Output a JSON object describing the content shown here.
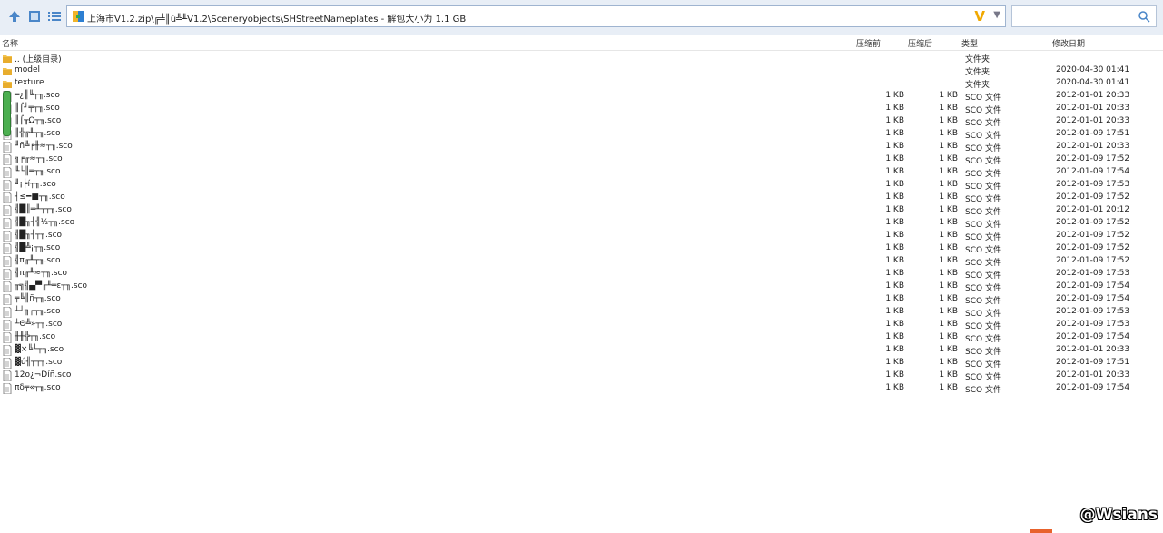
{
  "toolbar": {
    "icons": [
      "up-arrow-icon",
      "view-icon",
      "list-view-icon"
    ],
    "address": "上海市V1.2.zip\\╔╧║ú╩╨V1.2\\Sceneryobjects\\SHStreetNameplates - 解包大小为 1.1 GB",
    "search_placeholder": ""
  },
  "columns": {
    "name": "名称",
    "before": "压缩前",
    "after": "压缩后",
    "type": "类型",
    "date": "修改日期"
  },
  "rows": [
    {
      "icon": "folder",
      "name": ".. (上级目录)",
      "before": "",
      "after": "",
      "type": "文件夹",
      "date": ""
    },
    {
      "icon": "folder",
      "name": "model",
      "before": "",
      "after": "",
      "type": "文件夹",
      "date": "2020-04-30 01:41"
    },
    {
      "icon": "folder",
      "name": "texture",
      "before": "",
      "after": "",
      "type": "文件夹",
      "date": "2020-04-30 01:41"
    },
    {
      "icon": "file",
      "name": "═¿║╚┬╖.sco",
      "before": "1 KB",
      "after": "1 KB",
      "type": "SCO 文件",
      "date": "2012-01-01 20:33"
    },
    {
      "icon": "file",
      "name": "║⌠┘╤┬╖.sco",
      "before": "1 KB",
      "after": "1 KB",
      "type": "SCO 文件",
      "date": "2012-01-01 20:33"
    },
    {
      "icon": "file",
      "name": "║⌠╥Ω┬╖.sco",
      "before": "1 KB",
      "after": "1 KB",
      "type": "SCO 文件",
      "date": "2012-01-01 20:33"
    },
    {
      "icon": "file",
      "name": "║╬╔╨┬╖.sco",
      "before": "1 KB",
      "after": "1 KB",
      "type": "SCO 文件",
      "date": "2012-01-09 17:51"
    },
    {
      "icon": "file",
      "name": "╜ñ╩╒╫≈┬╖.sco",
      "before": "1 KB",
      "after": "1 KB",
      "type": "SCO 文件",
      "date": "2012-01-01 20:33"
    },
    {
      "icon": "file",
      "name": "╗╒╓≈┬╖.sco",
      "before": "1 KB",
      "after": "1 KB",
      "type": "SCO 文件",
      "date": "2012-01-09 17:52"
    },
    {
      "icon": "file",
      "name": "╙└║═┬╖.sco",
      "before": "1 KB",
      "after": "1 KB",
      "type": "SCO 文件",
      "date": "2012-01-09 17:54"
    },
    {
      "icon": "file",
      "name": "╝¡╞í┬╖.sco",
      "before": "1 KB",
      "after": "1 KB",
      "type": "SCO 文件",
      "date": "2012-01-09 17:53"
    },
    {
      "icon": "file",
      "name": "┤≤━■┬╖.sco",
      "before": "1 KB",
      "after": "1 KB",
      "type": "SCO 文件",
      "date": "2012-01-09 17:52"
    },
    {
      "icon": "file",
      "name": "╣█║═╨┬┬╖.sco",
      "before": "1 KB",
      "after": "1 KB",
      "type": "SCO 文件",
      "date": "2012-01-01 20:12"
    },
    {
      "icon": "file",
      "name": "╣█╖┤╣½┬╖.sco",
      "before": "1 KB",
      "after": "1 KB",
      "type": "SCO 文件",
      "date": "2012-01-09 17:52"
    },
    {
      "icon": "file",
      "name": "╣█╖┤┬╖.sco",
      "before": "1 KB",
      "after": "1 KB",
      "type": "SCO 文件",
      "date": "2012-01-09 17:52"
    },
    {
      "icon": "file",
      "name": "╣█╩¡┬╖.sco",
      "before": "1 KB",
      "after": "1 KB",
      "type": "SCO 文件",
      "date": "2012-01-09 17:52"
    },
    {
      "icon": "file",
      "name": "╣π╓╨┬╖.sco",
      "before": "1 KB",
      "after": "1 KB",
      "type": "SCO 文件",
      "date": "2012-01-09 17:52"
    },
    {
      "icon": "file",
      "name": "╣π╓╨≈┬╖.sco",
      "before": "1 KB",
      "after": "1 KB",
      "type": "SCO 文件",
      "date": "2012-01-09 17:53"
    },
    {
      "icon": "file",
      "name": "╥╗╣▄▀╓╨═ε┬╖.sco",
      "before": "1 KB",
      "after": "1 KB",
      "type": "SCO 文件",
      "date": "2012-01-09 17:54"
    },
    {
      "icon": "file",
      "name": "╤╚║ñ┬╖.sco",
      "before": "1 KB",
      "after": "1 KB",
      "type": "SCO 文件",
      "date": "2012-01-09 17:54"
    },
    {
      "icon": "file",
      "name": "┴┘╗┌┬╖.sco",
      "before": "1 KB",
      "after": "1 KB",
      "type": "SCO 文件",
      "date": "2012-01-09 17:53"
    },
    {
      "icon": "file",
      "name": "┴Θ╩»┬╖.sco",
      "before": "1 KB",
      "after": "1 KB",
      "type": "SCO 文件",
      "date": "2012-01-09 17:53"
    },
    {
      "icon": "file",
      "name": "╫╫╬┬╖.sco",
      "before": "1 KB",
      "after": "1 KB",
      "type": "SCO 文件",
      "date": "2012-01-09 17:54"
    },
    {
      "icon": "file",
      "name": "▓×╚└┬╖.sco",
      "before": "1 KB",
      "after": "1 KB",
      "type": "SCO 文件",
      "date": "2012-01-01 20:33"
    },
    {
      "icon": "file",
      "name": "▓ú╢┬┬╖.sco",
      "before": "1 KB",
      "after": "1 KB",
      "type": "SCO 文件",
      "date": "2012-01-09 17:51"
    },
    {
      "icon": "file",
      "name": "12o¿¬Díñ.sco",
      "before": "1 KB",
      "after": "1 KB",
      "type": "SCO 文件",
      "date": "2012-01-01 20:33"
    },
    {
      "icon": "file",
      "name": "πδ╤«┬╖.sco",
      "before": "1 KB",
      "after": "1 KB",
      "type": "SCO 文件",
      "date": "2012-01-09 17:54"
    }
  ],
  "watermark": "@Wsians",
  "colors": {
    "accent": "#f0a800",
    "folder": "#f2c24e",
    "toolbar_bg": "#e8eef6",
    "nav_blue": "#4a86c8"
  }
}
